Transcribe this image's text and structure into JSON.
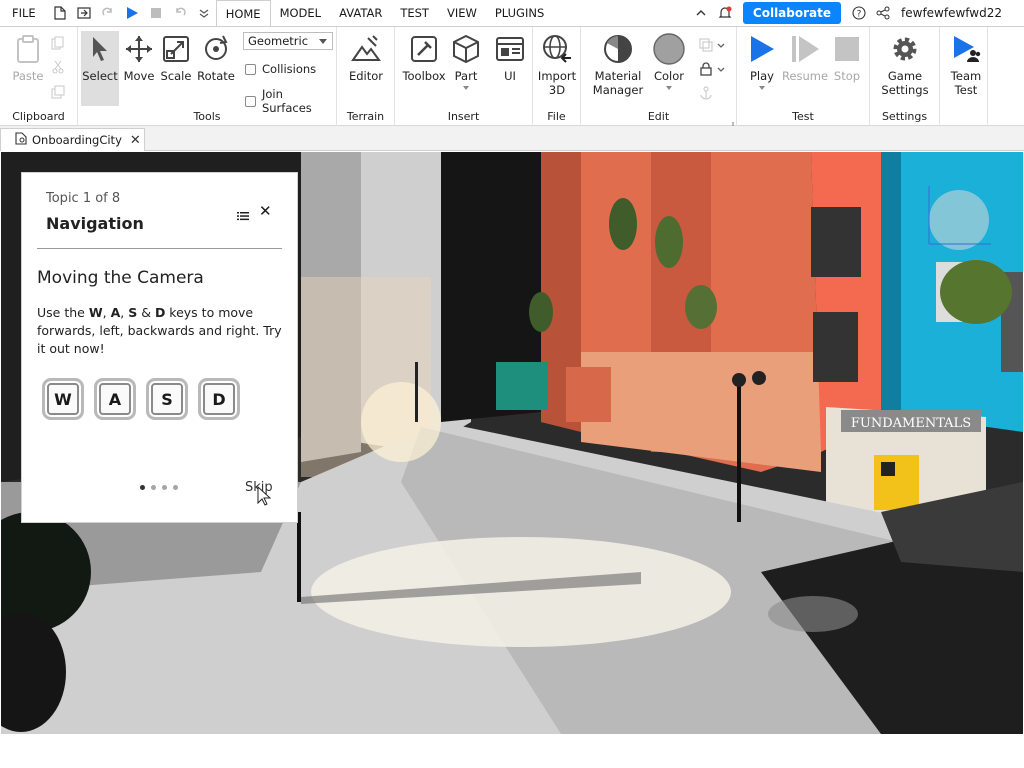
{
  "menu": {
    "file": "FILE",
    "tabs": [
      "HOME",
      "MODEL",
      "AVATAR",
      "TEST",
      "VIEW",
      "PLUGINS"
    ],
    "active_tab": "HOME",
    "collaborate": "Collaborate",
    "username": "fewfewfewfwd22"
  },
  "ribbon": {
    "clipboard": {
      "label": "Clipboard",
      "paste": "Paste"
    },
    "tools": {
      "label": "Tools",
      "select": "Select",
      "move": "Move",
      "scale": "Scale",
      "rotate": "Rotate",
      "mode": "Geometric",
      "collisions": "Collisions",
      "join_surfaces": "Join Surfaces"
    },
    "terrain": {
      "label": "Terrain",
      "editor": "Editor"
    },
    "insert": {
      "label": "Insert",
      "toolbox": "Toolbox",
      "part": "Part",
      "ui": "UI"
    },
    "file": {
      "label": "File",
      "import_line1": "Import",
      "import_line2": "3D"
    },
    "edit": {
      "label": "Edit",
      "material_line1": "Material",
      "material_line2": "Manager",
      "color": "Color"
    },
    "test": {
      "label": "Test",
      "play": "Play",
      "resume": "Resume",
      "stop": "Stop"
    },
    "settings": {
      "label": "Settings",
      "game_line1": "Game",
      "game_line2": "Settings",
      "team_line1": "Team",
      "team_line2": "Test"
    }
  },
  "document_tab": {
    "name": "OnboardingCity"
  },
  "scene": {
    "sign_text": "FUNDAMENTALS"
  },
  "tutorial": {
    "topic": "Topic 1 of 8",
    "title": "Navigation",
    "heading": "Moving the Camera",
    "desc_parts": [
      "Use the ",
      "W",
      ", ",
      "A",
      ", ",
      "S",
      " & ",
      "D",
      " keys to move forwards, left, backwards and right. Try it out now!"
    ],
    "keys": [
      "W",
      "A",
      "S",
      "D"
    ],
    "skip": "Skip",
    "pages_total": 4,
    "page_current": 1
  },
  "colors": {
    "accent": "#0a84ff",
    "play_blue": "#1a73e8"
  }
}
